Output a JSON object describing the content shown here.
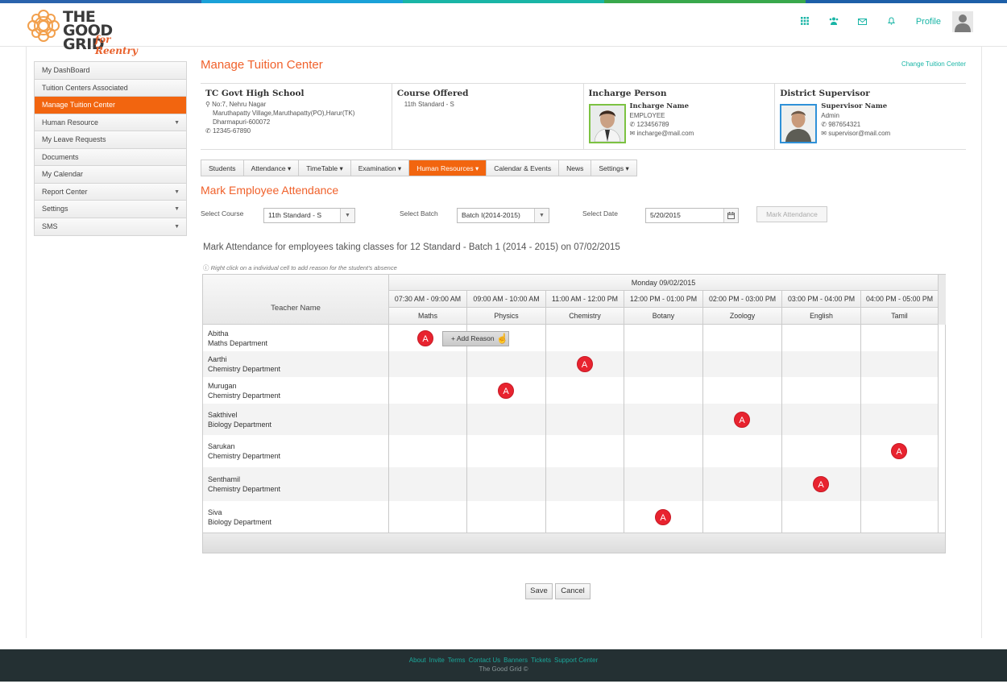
{
  "brand": {
    "logo_line1": "THE GOOD",
    "logo_line2": "GRID",
    "logo_tagline": "for Reentry",
    "stripe_colors": [
      "#2a63ac",
      "#1aa1d8",
      "#19b5a6",
      "#39a84c",
      "#1d5fa8"
    ]
  },
  "header": {
    "icons": [
      "grid-icon",
      "users-icon",
      "mail-icon",
      "bell-icon"
    ],
    "profile_label": "Profile"
  },
  "sidebar": {
    "items": [
      {
        "label": "My DashBoard",
        "caret": false,
        "active": false
      },
      {
        "label": "Tuition Centers Associated",
        "caret": false,
        "active": false
      },
      {
        "label": "Manage Tuition Center",
        "caret": false,
        "active": true
      },
      {
        "label": "Human Resource",
        "caret": true,
        "active": false
      },
      {
        "label": "My Leave Requests",
        "caret": false,
        "active": false
      },
      {
        "label": "Documents",
        "caret": false,
        "active": false
      },
      {
        "label": "My Calendar",
        "caret": false,
        "active": false
      },
      {
        "label": "Report Center",
        "caret": true,
        "active": false
      },
      {
        "label": "Settings",
        "caret": true,
        "active": false
      },
      {
        "label": "SMS",
        "caret": true,
        "active": false
      }
    ]
  },
  "main": {
    "title": "Manage Tuition Center",
    "change_link": "Change Tuition Center",
    "center": {
      "name": "TC Govt High School",
      "addr1": "No:7, Nehru Nagar",
      "addr2": "Maruthapatty Village,Maruthapatty(PO),Harur(TK)",
      "addr3": "Dharmapuri-600072",
      "phone": "12345-67890"
    },
    "course": {
      "heading": "Course Offered",
      "value": "11th Standard - S"
    },
    "incharge": {
      "heading": "Incharge Person",
      "name": "Incharge Name",
      "role": "EMPLOYEE",
      "phone": "123456789",
      "email": "incharge@mail.com"
    },
    "supervisor": {
      "heading": "District Supervisor",
      "name": "Supervisor Name",
      "role": "Admin",
      "phone": "987654321",
      "email": "supervisor@mail.com"
    },
    "tabs": [
      {
        "label": "Students",
        "caret": false,
        "active": false
      },
      {
        "label": "Attendance",
        "caret": true,
        "active": false
      },
      {
        "label": "TimeTable",
        "caret": true,
        "active": false
      },
      {
        "label": "Examination",
        "caret": true,
        "active": false
      },
      {
        "label": "Human Resources",
        "caret": true,
        "active": true
      },
      {
        "label": "Calendar & Events",
        "caret": false,
        "active": false
      },
      {
        "label": "News",
        "caret": false,
        "active": false
      },
      {
        "label": "Settings",
        "caret": true,
        "active": false
      }
    ],
    "section_title": "Mark Employee Attendance",
    "filters": {
      "course_label": "Select Course",
      "course_value": "11th Standard - S",
      "batch_label": "Select Batch",
      "batch_value": "Batch I(2014-2015)",
      "date_label": "Select Date",
      "date_value": "5/20/2015",
      "mark_button": "Mark Attendance"
    },
    "description": "Mark Attendance for employees taking classes for 12 Standard - Batch 1 (2014 - 2015) on 07/02/2015",
    "hint": "Right click on a individual cell to add reason for the student's absence"
  },
  "attendance": {
    "teacher_header": "Teacher Name",
    "day_header": "Monday 09/02/2015",
    "periods": [
      {
        "time": "07:30 AM - 09:00 AM",
        "subject": "Maths"
      },
      {
        "time": "09:00 AM - 10:00 AM",
        "subject": "Physics"
      },
      {
        "time": "11:00 AM - 12:00 PM",
        "subject": "Chemistry"
      },
      {
        "time": "12:00 PM - 01:00 PM",
        "subject": "Botany"
      },
      {
        "time": "02:00 PM - 03:00 PM",
        "subject": "Zoology"
      },
      {
        "time": "03:00 PM - 04:00 PM",
        "subject": "English"
      },
      {
        "time": "04:00 PM - 05:00 PM",
        "subject": "Tamil"
      }
    ],
    "absent_mark": "A",
    "add_reason_label": "+ Add Reason",
    "teachers": [
      {
        "name": "Abitha",
        "dept": "Maths Department",
        "absent_period": 0
      },
      {
        "name": "Aarthi",
        "dept": "Chemistry Department",
        "absent_period": 2
      },
      {
        "name": "Murugan",
        "dept": "Chemistry Department",
        "absent_period": 1
      },
      {
        "name": "Sakthivel",
        "dept": "Biology Department",
        "absent_period": 4
      },
      {
        "name": "Sarukan",
        "dept": "Chemistry Department",
        "absent_period": 6
      },
      {
        "name": "Senthamil",
        "dept": "Chemistry Department",
        "absent_period": 5
      },
      {
        "name": "Siva",
        "dept": "Biology Department",
        "absent_period": 3
      }
    ]
  },
  "actions": {
    "save": "Save",
    "cancel": "Cancel"
  },
  "footer": {
    "links": [
      "About",
      "Invite",
      "Terms",
      "Contact Us",
      "Banners",
      "Tickets",
      "Support Center"
    ],
    "copyright": "The Good Grid ©"
  }
}
